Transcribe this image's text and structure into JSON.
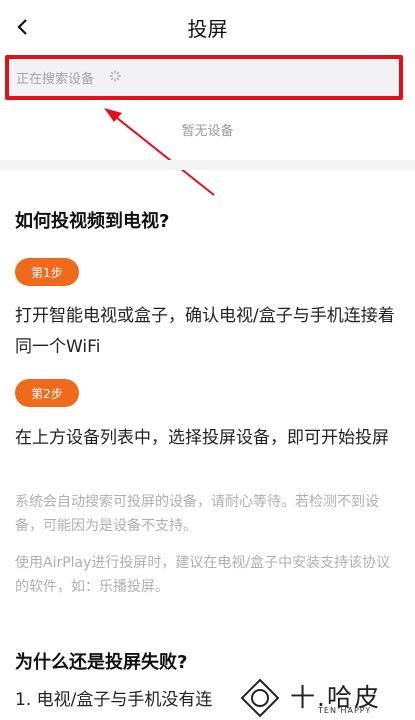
{
  "header": {
    "title": "投屏",
    "back_icon": "chevron-left-icon"
  },
  "search": {
    "status_text": "正在搜索设备",
    "spinner_icon": "loading-spinner-icon"
  },
  "device_list": {
    "empty_text": "暂无设备"
  },
  "guide": {
    "heading": "如何投视频到电视?",
    "steps": [
      {
        "badge": "第1步",
        "text": "打开智能电视或盒子，确认电视/盒子与手机连接着同一个WiFi"
      },
      {
        "badge": "第2步",
        "text": "在上方设备列表中，选择投屏设备，即可开始投屏"
      }
    ],
    "notes": [
      "系统会自动搜索可投屏的设备，请耐心等待。若检测不到设备，可能因为是设备不支持。",
      "使用AirPlay进行投屏时，建议在电视/盒子中安装支持该协议的软件，如：乐播投屏。"
    ]
  },
  "faq": {
    "heading": "为什么还是投屏失败?",
    "items": [
      {
        "text": "1. 电视/盒子与手机没有连"
      }
    ]
  },
  "watermark": {
    "text": "十.哈皮",
    "sub": "TEN HAPPY"
  },
  "colors": {
    "accent": "#f06a1d",
    "highlight": "#e3101c"
  }
}
